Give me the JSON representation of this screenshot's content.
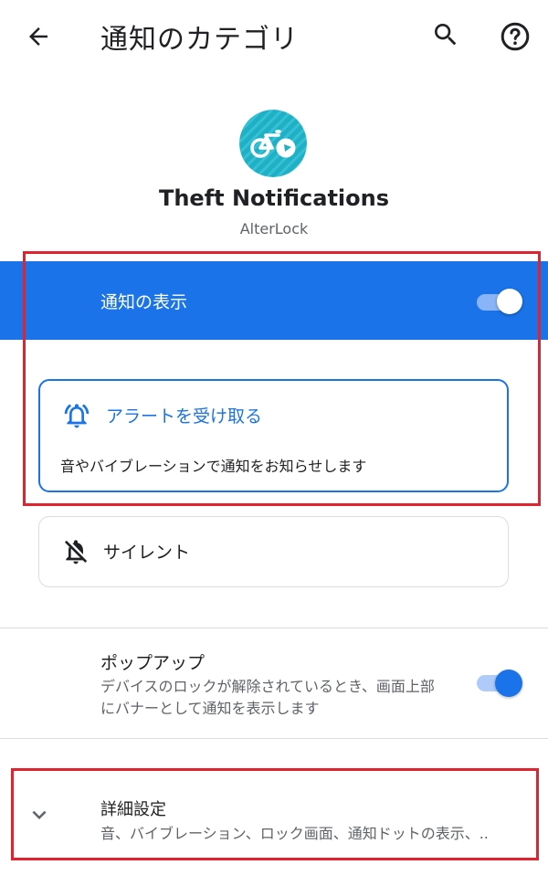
{
  "header": {
    "title": "通知のカテゴリ",
    "back_icon": "arrow-back-icon",
    "search_icon": "search-icon",
    "help_icon": "help-icon"
  },
  "app": {
    "icon": "bicycle-app-icon",
    "name": "Theft Notifications",
    "developer": "AlterLock"
  },
  "show_notifications": {
    "label": "通知の表示",
    "enabled": true
  },
  "behavior_options": {
    "alert": {
      "title": "アラートを受け取る",
      "description": "音やバイブレーションで通知をお知らせします",
      "icon": "bell-ringing-icon",
      "selected": true
    },
    "silent": {
      "title": "サイレント",
      "icon": "bell-off-icon",
      "selected": false
    }
  },
  "popup": {
    "title": "ポップアップ",
    "description": "デバイスのロックが解除されているとき、画面上部にバナーとして通知を表示します",
    "enabled": true
  },
  "advanced": {
    "title": "詳細設定",
    "summary": "音、バイブレーション、ロック画面、通知ドットの表示、..",
    "icon": "chevron-down-icon"
  },
  "colors": {
    "accent": "#1a73e8",
    "highlight_box": "#e0232e",
    "app_icon_bg": "#26b5c9"
  }
}
